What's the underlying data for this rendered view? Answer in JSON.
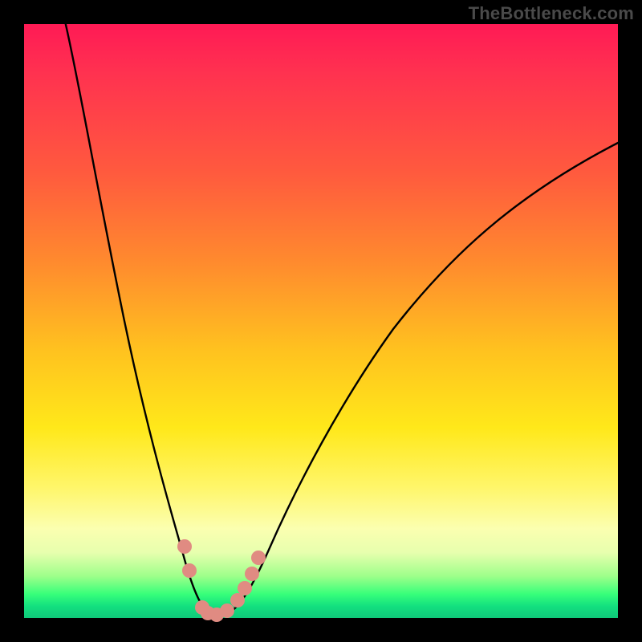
{
  "watermark": {
    "text": "TheBottleneck.com"
  },
  "chart_data": {
    "type": "line",
    "title": "",
    "xlabel": "",
    "ylabel": "",
    "xlim": [
      0,
      100
    ],
    "ylim": [
      0,
      100
    ],
    "series": [
      {
        "name": "bottleneck-curve",
        "x": [
          7,
          10,
          14,
          18,
          22,
          25,
          27,
          29,
          30.5,
          31.5,
          33,
          35,
          38,
          42,
          48,
          55,
          62,
          70,
          78,
          86,
          94,
          100
        ],
        "values": [
          100,
          86,
          70,
          53,
          36,
          22,
          12,
          5,
          1.5,
          0.5,
          0.5,
          1.5,
          4,
          10,
          21,
          34,
          45,
          55,
          63,
          70,
          76,
          80
        ]
      }
    ],
    "markers": {
      "name": "salmon-dots",
      "color": "#e08b82",
      "points": [
        {
          "x": 27.0,
          "y": 12
        },
        {
          "x": 27.8,
          "y": 8
        },
        {
          "x": 30.0,
          "y": 1.8
        },
        {
          "x": 31.0,
          "y": 0.8
        },
        {
          "x": 32.5,
          "y": 0.6
        },
        {
          "x": 34.2,
          "y": 1.2
        },
        {
          "x": 36.0,
          "y": 3.0
        },
        {
          "x": 37.2,
          "y": 5.0
        },
        {
          "x": 38.4,
          "y": 7.5
        },
        {
          "x": 39.4,
          "y": 10.2
        }
      ]
    },
    "gradient_stops": [
      {
        "pos": 0,
        "color": "#ff1a55"
      },
      {
        "pos": 25,
        "color": "#ff5a3e"
      },
      {
        "pos": 55,
        "color": "#ffc21f"
      },
      {
        "pos": 85,
        "color": "#fbffb0"
      },
      {
        "pos": 100,
        "color": "#0fc97a"
      }
    ]
  }
}
